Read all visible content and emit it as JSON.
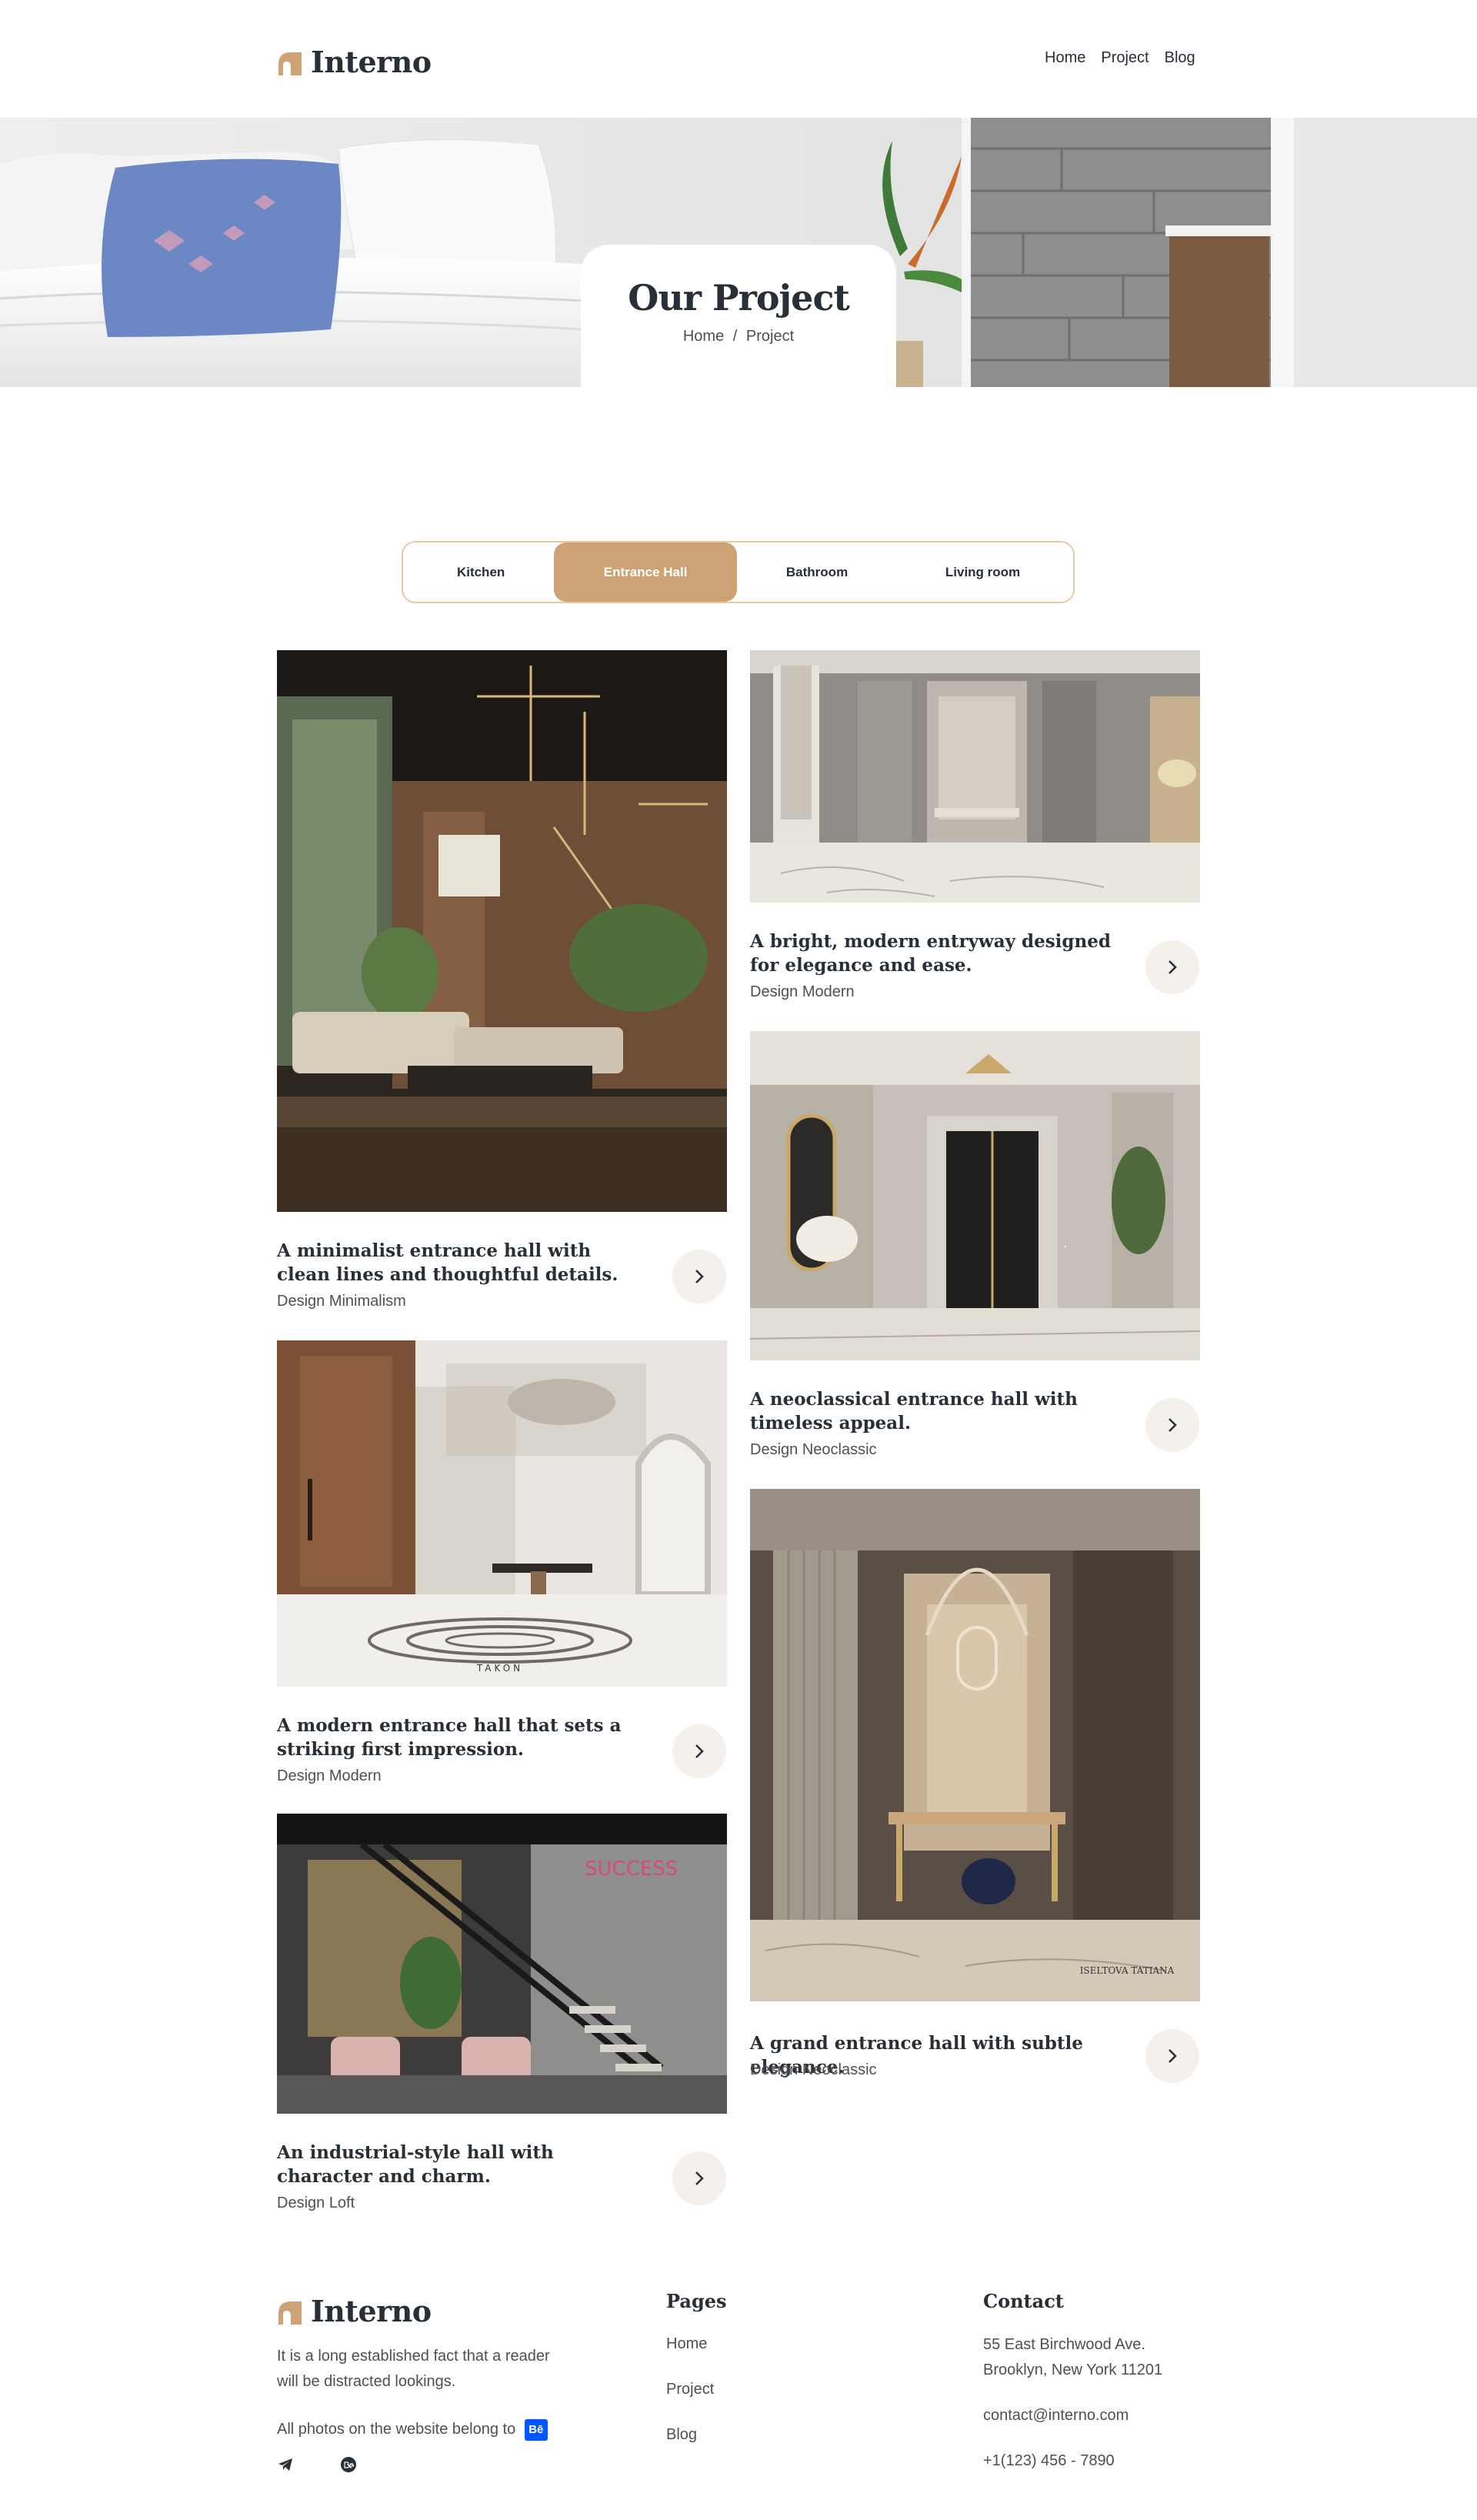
{
  "brand": {
    "name": "Interno",
    "accent": "#cda274",
    "dark": "#292f36"
  },
  "nav": {
    "items": [
      "Home",
      "Project",
      "Blog"
    ]
  },
  "hero": {
    "title": "Our Project",
    "breadcrumb_home": "Home",
    "breadcrumb_sep": "/",
    "breadcrumb_current": "Project"
  },
  "tabs": [
    {
      "label": "Kitchen",
      "active": false
    },
    {
      "label": "Entrance Hall",
      "active": true
    },
    {
      "label": "Bathroom",
      "active": false
    },
    {
      "label": "Living room",
      "active": false
    }
  ],
  "projects": [
    {
      "title": "A minimalist entrance hall with clean lines and thoughtful details.",
      "subtitle": "Design Minimalism"
    },
    {
      "title": "A modern entrance hall that sets a striking first impression.",
      "subtitle": "Design Modern"
    },
    {
      "title": "An industrial-style hall with character and charm.",
      "subtitle": "Design Loft"
    },
    {
      "title": "A bright, modern entryway designed for elegance and ease.",
      "subtitle": "Design Modern"
    },
    {
      "title": "A neoclassical entrance hall with timeless appeal.",
      "subtitle": "Design Neoclassic"
    },
    {
      "title": "A grand entrance hall with subtle elegance.",
      "subtitle": "Design Neoclassic"
    }
  ],
  "image_marks": {
    "takon": "TAKON",
    "success": "SUCCESS",
    "iseltova": "ISELTOVA TATIANA"
  },
  "footer": {
    "brand": "Interno",
    "description": "It is a long established fact that a reader will be distracted lookings.",
    "photos_note": "All photos on the website belong to",
    "behance_badge": "Bē",
    "pages_heading": "Pages",
    "pages": [
      "Home",
      "Project",
      "Blog"
    ],
    "contact_heading": "Contact",
    "address_line1": "55 East Birchwood Ave.",
    "address_line2": "Brooklyn, New York 11201",
    "email": "contact@interno.com",
    "phone": "+1(123) 456 - 7890",
    "social_icons": [
      "telegram-icon",
      "behance-icon"
    ]
  }
}
